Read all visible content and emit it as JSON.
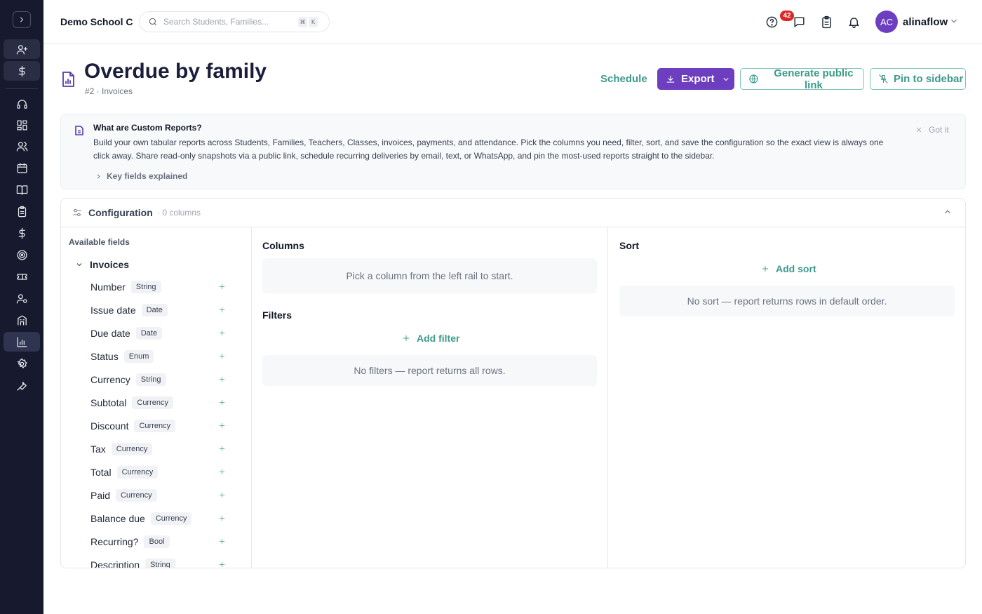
{
  "topbar": {
    "school": "Demo School C",
    "search_placeholder": "Search Students, Families...",
    "shortcut_keys": [
      "⌘",
      "K"
    ],
    "notification_count": "42",
    "avatar_initials": "AC",
    "username": "alinaflow"
  },
  "rail": {
    "icons": [
      "expand-icon",
      "user-plus-icon",
      "dollar-icon",
      "headset-icon",
      "dashboard-icon",
      "users-icon",
      "calendar-icon",
      "book-icon",
      "clipboard-icon",
      "dollar-icon",
      "target-icon",
      "ticket-icon",
      "user-gear-icon",
      "building-icon",
      "chart-icon",
      "settings-icon",
      "wrench-icon"
    ],
    "active": "chart-icon"
  },
  "header": {
    "title": "Overdue by family",
    "subtitle": "#2 · Invoices",
    "schedule_label": "Schedule",
    "export_label": "Export",
    "public_link_label": "Generate public link",
    "pin_label": "Pin to sidebar"
  },
  "info": {
    "title": "What are Custom Reports?",
    "body": "Build your own tabular reports across Students, Families, Teachers, Classes, invoices, payments, and attendance. Pick the columns you need, filter, sort, and save the configuration so the exact view is always one click away. Share read-only snapshots via a public link, schedule recurring deliveries by email, text, or WhatsApp, and pin the most-used reports straight to the sidebar.",
    "key_fields_label": "Key fields explained",
    "dismiss_label": "Got it"
  },
  "config": {
    "title": "Configuration",
    "count": "· 0 columns",
    "available_label": "Available fields",
    "group": "Invoices",
    "fields": [
      {
        "name": "Number",
        "type": "String"
      },
      {
        "name": "Issue date",
        "type": "Date"
      },
      {
        "name": "Due date",
        "type": "Date"
      },
      {
        "name": "Status",
        "type": "Enum"
      },
      {
        "name": "Currency",
        "type": "String"
      },
      {
        "name": "Subtotal",
        "type": "Currency"
      },
      {
        "name": "Discount",
        "type": "Currency"
      },
      {
        "name": "Tax",
        "type": "Currency"
      },
      {
        "name": "Total",
        "type": "Currency"
      },
      {
        "name": "Paid",
        "type": "Currency"
      },
      {
        "name": "Balance due",
        "type": "Currency"
      },
      {
        "name": "Recurring?",
        "type": "Bool"
      },
      {
        "name": "Description",
        "type": "String"
      }
    ],
    "columns_title": "Columns",
    "columns_empty": "Pick a column from the left rail to start.",
    "filters_title": "Filters",
    "add_filter_label": "Add filter",
    "filters_empty": "No filters — report returns all rows.",
    "sort_title": "Sort",
    "add_sort_label": "Add sort",
    "sort_empty": "No sort — report returns rows in default order."
  },
  "colors": {
    "rail_bg": "#171a2e",
    "accent_purple": "#6d3fc0",
    "accent_teal": "#3d9a8b",
    "badge_red": "#dc2626"
  }
}
